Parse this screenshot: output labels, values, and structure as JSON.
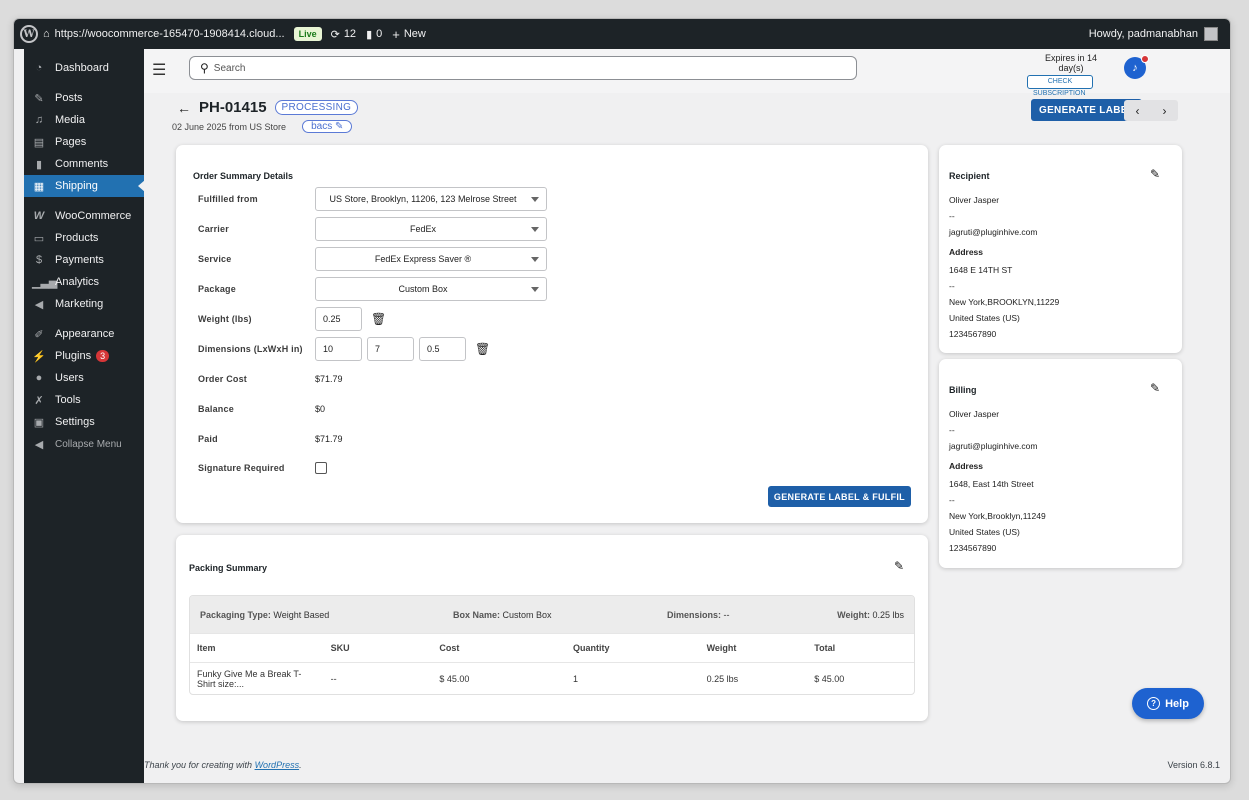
{
  "adminbar": {
    "url": "https://woocommerce-165470-1908414.cloud...",
    "live": "Live",
    "updates": "12",
    "comments": "0",
    "new": "New",
    "howdy": "Howdy, padmanabhan"
  },
  "sidebar": {
    "items": [
      {
        "label": "Dashboard",
        "icon": "dashboard-icon"
      },
      {
        "label": "Posts",
        "icon": "pin-icon"
      },
      {
        "label": "Media",
        "icon": "media-icon"
      },
      {
        "label": "Pages",
        "icon": "page-icon"
      },
      {
        "label": "Comments",
        "icon": "comment-icon"
      },
      {
        "label": "Shipping",
        "icon": "grid-icon"
      },
      {
        "label": "WooCommerce",
        "icon": "woo-icon"
      },
      {
        "label": "Products",
        "icon": "archive-icon"
      },
      {
        "label": "Payments",
        "icon": "dollar-icon"
      },
      {
        "label": "Analytics",
        "icon": "chart-icon"
      },
      {
        "label": "Marketing",
        "icon": "megaphone-icon"
      },
      {
        "label": "Appearance",
        "icon": "brush-icon"
      },
      {
        "label": "Plugins",
        "icon": "plug-icon",
        "badge": "3"
      },
      {
        "label": "Users",
        "icon": "user-icon"
      },
      {
        "label": "Tools",
        "icon": "wrench-icon"
      },
      {
        "label": "Settings",
        "icon": "settings-icon"
      },
      {
        "label": "Collapse Menu",
        "icon": "collapse-icon"
      }
    ]
  },
  "topbar": {
    "search_placeholder": "Search",
    "expires": "Expires in 14 day(s)",
    "check": "CHECK",
    "subscription": "SUBSCRIPTION"
  },
  "order": {
    "id": "PH-01415",
    "status": "PROCESSING",
    "subtitle": "02 June 2025 from US Store",
    "payment": "bacs",
    "generate_label": "GENERATE LABEL"
  },
  "summary": {
    "title": "Order Summary Details",
    "fulfilled_label": "Fulfilled from",
    "fulfilled_value": "US Store, Brooklyn, 11206, 123 Melrose Street",
    "carrier_label": "Carrier",
    "carrier_value": "FedEx",
    "service_label": "Service",
    "service_value": "FedEx Express Saver ®",
    "package_label": "Package",
    "package_value": "Custom Box",
    "weight_label": "Weight  (lbs)",
    "weight_value": "0.25",
    "dims_label": "Dimensions (LxWxH in)",
    "dim_l": "10",
    "dim_w": "7",
    "dim_h": "0.5",
    "cost_label": "Order Cost",
    "cost_value": "$71.79",
    "balance_label": "Balance",
    "balance_value": "$0",
    "paid_label": "Paid",
    "paid_value": "$71.79",
    "signature_label": "Signature Required",
    "generate_fulfil": "GENERATE LABEL & FULFIL"
  },
  "recipient": {
    "title": "Recipient",
    "name": "Oliver Jasper",
    "dash1": "--",
    "email": "jagruti@pluginhive.com",
    "address_title": "Address",
    "street": "1648 E 14TH ST",
    "dash2": "--",
    "city": "New York,BROOKLYN,11229",
    "country": "United States (US)",
    "phone": "1234567890"
  },
  "billing": {
    "title": "Billing",
    "name": "Oliver Jasper",
    "dash1": "--",
    "email": "jagruti@pluginhive.com",
    "address_title": "Address",
    "street": "1648, East 14th Street",
    "dash2": "--",
    "city": "New York,Brooklyn,11249",
    "country": "United States (US)",
    "phone": "1234567890"
  },
  "packing": {
    "title": "Packing Summary",
    "type_label": "Packaging Type:",
    "type_value": "Weight Based",
    "box_label": "Box Name:",
    "box_value": "Custom Box",
    "dims_label": "Dimensions:",
    "dims_value": "--",
    "weight_label": "Weight:",
    "weight_value": "0.25 lbs",
    "headers": [
      "Item",
      "SKU",
      "Cost",
      "Quantity",
      "Weight",
      "Total"
    ],
    "rows": [
      [
        "Funky Give Me a Break T-Shirt size:...",
        "--",
        "$ 45.00",
        "1",
        "0.25 lbs",
        "$ 45.00"
      ]
    ]
  },
  "help": "Help",
  "footer": {
    "thanks": "Thank you for creating with ",
    "link": "WordPress",
    "period": ".",
    "version": "Version 6.8.1"
  }
}
